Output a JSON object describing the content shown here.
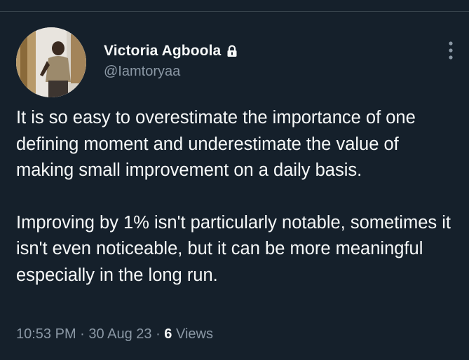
{
  "author": {
    "display_name": "Victoria Agboola",
    "handle": "@Iamtoryaa",
    "protected_icon": "lock-icon",
    "avatar_icon": "profile-photo"
  },
  "menu": {
    "icon": "more-vertical-icon"
  },
  "tweet": {
    "paragraphs": [
      "It is so easy to overestimate the importance of one defining moment and underestimate the value of making small improvement on a daily basis.",
      "Improving by 1% isn't particularly notable, sometimes it isn't even noticeable, but it can be more meaningful especially in the long run."
    ],
    "time": "10:53 PM",
    "separator": "·",
    "date": "30 Aug 23",
    "views_count": "6",
    "views_label": "Views"
  },
  "colors": {
    "background": "#15202b",
    "text_primary": "#f7f9f9",
    "text_secondary": "#8b98a5"
  }
}
